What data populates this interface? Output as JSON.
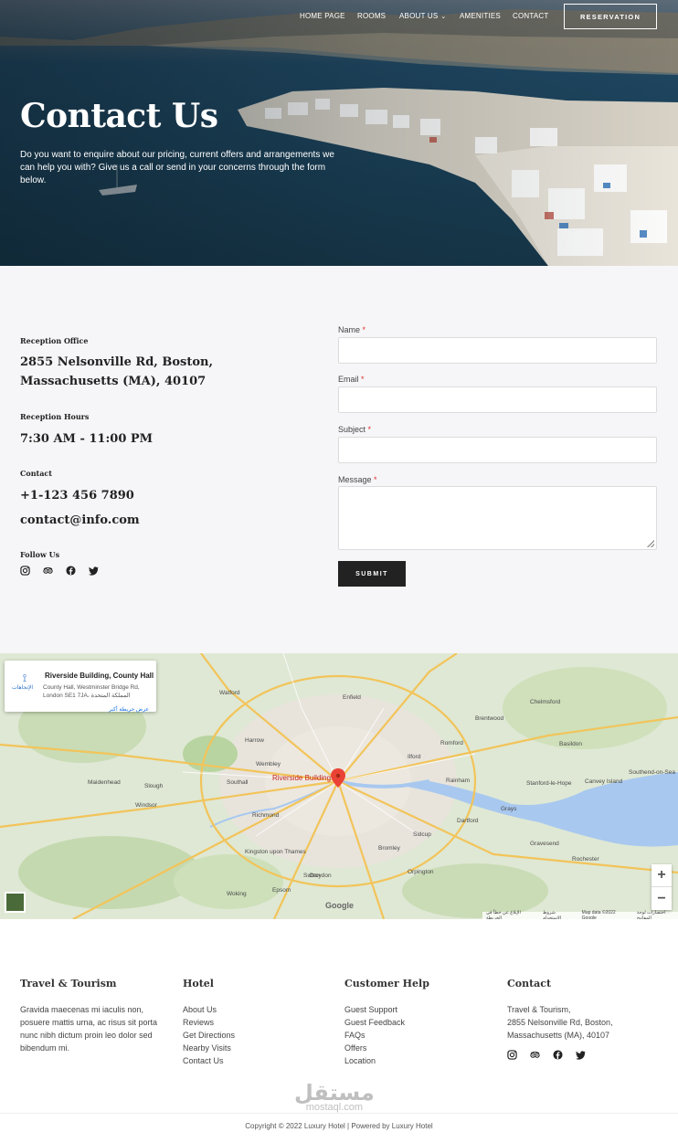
{
  "nav": {
    "home": "HOME PAGE",
    "rooms": "ROOMS",
    "about": "ABOUT US",
    "amenities": "AMENITIES",
    "contact": "CONTACT",
    "reservation": "RESERVATION"
  },
  "hero": {
    "title": "Contact Us",
    "text": "Do you want to enquire about our pricing, current offers and arrangements we can help you with? Give us a call or send in your concerns through the form below."
  },
  "info": {
    "office_label": "Reception Office",
    "office_value": "2855 Nelsonville Rd, Boston, Massachusetts (MA), 40107",
    "hours_label": "Reception Hours",
    "hours_value": "7:30 AM - 11:00 PM",
    "contact_label": "Contact",
    "phone": "+1-123 456 7890",
    "email": "contact@info.com",
    "follow_label": "Follow Us"
  },
  "form": {
    "name_label": "Name",
    "email_label": "Email",
    "subject_label": "Subject",
    "message_label": "Message",
    "required_mark": "*",
    "submit": "SUBMIT"
  },
  "map": {
    "place_title": "Riverside Building, County Hall",
    "place_address": "County Hall, Westminster Bridge Rd, London SE1 7JA، المملكة المتحدة",
    "logo_text": "الإتجاهات",
    "view_larger": "عرض خريطة أكبر",
    "pin_label": "Riverside Building",
    "zoom_in": "+",
    "zoom_out": "−",
    "google": "Google",
    "attr_1": "اختصارات لوحة المفاتيح",
    "attr_2": "Map data ©2022 Google",
    "attr_3": "شروط الاستخدام",
    "attr_4": "الإبلاغ عن خطأ في الخريطة",
    "towns": [
      "Watford",
      "Enfield",
      "Harrow",
      "Wembley",
      "Romford",
      "Ilford",
      "Southall",
      "Slough",
      "Windsor",
      "Richmond",
      "Croydon",
      "Bromley",
      "Sidcup",
      "Dartford",
      "Basildon",
      "Chelmsford",
      "Brentwood",
      "Southend-on-Sea",
      "Woking",
      "Epsom",
      "Sutton",
      "Kingston upon Thames",
      "Orpington",
      "Maidenhead",
      "Grays",
      "Rainham",
      "Stanford-le-Hope",
      "Canvey Island",
      "Rochester",
      "Gravesend"
    ]
  },
  "footer": {
    "col1_title": "Travel & Tourism",
    "col1_text": "Gravida maecenas mi iaculis non, posuere mattis urna, ac risus sit porta nunc nibh dictum proin leo dolor sed bibendum mi.",
    "col2_title": "Hotel",
    "col2_links": [
      "About Us",
      "Reviews",
      "Get Directions",
      "Nearby Visits",
      "Contact Us"
    ],
    "col3_title": "Customer Help",
    "col3_links": [
      "Guest Support",
      "Guest Feedback",
      "FAQs",
      "Offers",
      "Location"
    ],
    "col4_title": "Contact",
    "col4_line1": "Travel & Tourism,",
    "col4_line2": "2855 Nelsonville Rd, Boston,",
    "col4_line3": "Massachusetts (MA), 40107",
    "watermark_ar": "مستقل",
    "watermark_en": "mostaql.com",
    "copyright": "Copyright © 2022 Luxury Hotel | Powered by Luxury Hotel"
  },
  "icons": {
    "social": [
      "instagram-icon",
      "tripadvisor-icon",
      "facebook-icon",
      "twitter-icon"
    ]
  },
  "colors": {
    "accent_dark": "#222222",
    "required": "#dd3333",
    "map_pin": "#ea4335"
  }
}
